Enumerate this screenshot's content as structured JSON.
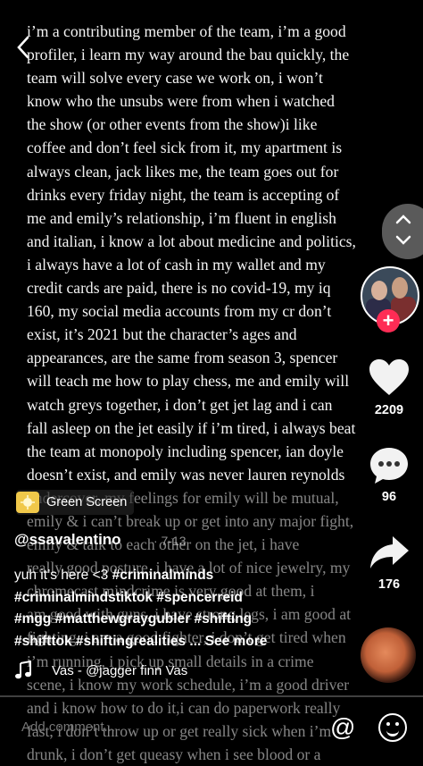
{
  "post": {
    "lines": [
      "i’m a contributing member of the team, i’m a good",
      "profiler, i learn my way around the bau quickly, the",
      "team will solve every case we work on, i won’t",
      "know who the unsubs were from when i watched",
      "the show (or other events from the show)i like",
      "coffee and don’t feel sick from it, my apartment is",
      "always clean, jack likes me, the team goes out for",
      "drinks every friday night, the team is accepting of",
      "me and emily’s relationship, i’m fluent in english",
      "and italian, i know a lot about medicine and politics,",
      "i always have a lot of cash in my wallet and my",
      "credit cards are paid, there is no covid-19, my iq",
      "160, my social media accounts from my cr don’t",
      "exist, it’s 2021 but the character’s ages and",
      "appearances, are the same from season 3, spencer",
      "will teach me how to play chess, me and emily will",
      "watch greys together, i don’t get jet lag and i can",
      "fall asleep on the jet easily if i’m tired, i always beat",
      "the team at monopoly including spencer, ian doyle",
      "doesn’t exist, and emily was never lauren reynolds",
      "undercover, my feelings for emily will be mutual,",
      "emily & i can’t break up or get into any major fight,",
      "emily &   talk to each other on the jet, i have",
      "really good posture, i have a lot of nice jewelry, my",
      "chromecast mindcrime is very good at them, i",
      "am good with guns, i have strong legs, i am good at",
      "fighting, i am a good fighter, i don’t get tired when",
      "i’m running, i pick up small details in a crime",
      "scene, i know my work schedule, i’m a good driver",
      "and i know how to do it,i can do paperwork really",
      "fast, i don’t throw up or get really sick when i’m",
      "drunk, i don’t get queasy when i see blood or a"
    ]
  },
  "nav": {
    "back_icon": "chevron-left-icon"
  },
  "actions": {
    "likes": "2209",
    "comments": "96",
    "shares": "176"
  },
  "effect": {
    "label": "Green Screen"
  },
  "author": {
    "handle": "@ssavalentino",
    "date": "· 7-13"
  },
  "caption": {
    "text": "yuh it’s here <3",
    "tags_line1": "#criminalminds",
    "tags_line2": "#criminalmindstiktok #spencerreid",
    "tags_line3": "#mgg #matthewgraygubler #shifting",
    "tags_line4": "#shifttok #shiftingrealities",
    "see_more": "... See more"
  },
  "music": {
    "text": "Vas - @jagger finn   Vas"
  },
  "progress": 0.0,
  "comment": {
    "placeholder": "Add comment..."
  },
  "colors": {
    "accent": "#fe2c55",
    "background": "#000000"
  }
}
